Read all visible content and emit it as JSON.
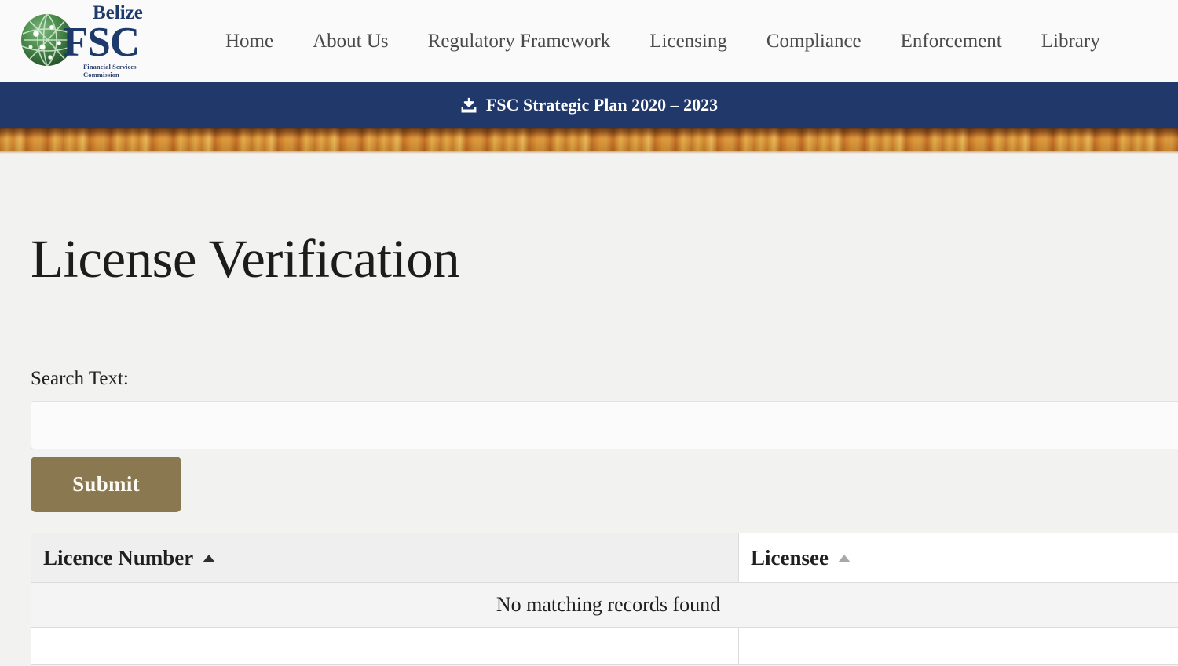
{
  "header": {
    "logo": {
      "brand_top": "Belize",
      "brand_main": "FSC",
      "brand_sub": "Financial Services Commission",
      "globe_icon": "globe-network-icon"
    },
    "nav": [
      {
        "label": "Home"
      },
      {
        "label": "About Us"
      },
      {
        "label": "Regulatory Framework"
      },
      {
        "label": "Licensing"
      },
      {
        "label": "Compliance"
      },
      {
        "label": "Enforcement"
      },
      {
        "label": "Library"
      }
    ]
  },
  "announcement": {
    "icon": "download-icon",
    "label": "FSC Strategic Plan 2020 – 2023",
    "background_color": "#21386b",
    "text_color": "#ffffff"
  },
  "main": {
    "title": "License Verification",
    "search": {
      "label": "Search Text:",
      "value": "",
      "placeholder": ""
    },
    "submit_label": "Submit",
    "submit_color": "#8a7850"
  },
  "table": {
    "columns": [
      {
        "label": "Licence Number",
        "sort": "ascending",
        "active": true
      },
      {
        "label": "Licensee",
        "sort": "ascending",
        "active": false
      }
    ],
    "empty_message": "No matching records found",
    "rows": []
  }
}
